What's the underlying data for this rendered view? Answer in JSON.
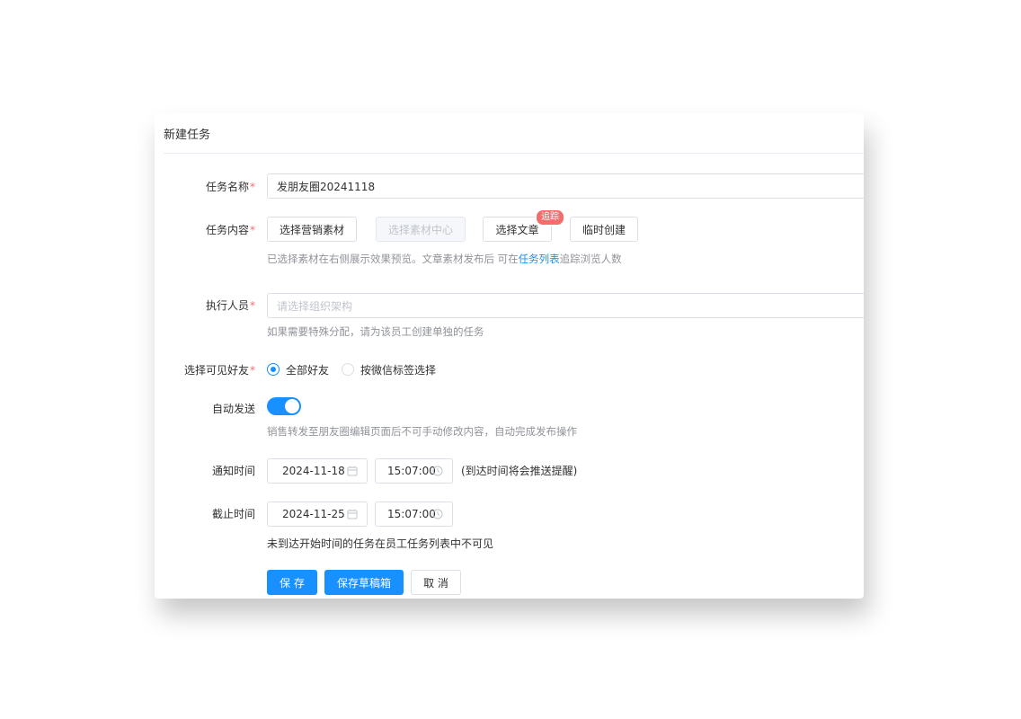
{
  "form": {
    "title": "新建任务",
    "task_name": {
      "label": "任务名称",
      "required_mark": "*",
      "value": "发朋友圈20241118"
    },
    "task_content": {
      "label": "任务内容",
      "required_mark": "*",
      "buttons": {
        "select_marketing": "选择营销素材",
        "select_center": "选择素材中心",
        "select_article": "选择文章",
        "temp_create": "临时创建"
      },
      "badge": "追踪",
      "hint_prefix": "已选择素材在右侧展示效果预览。文章素材发布后 可在",
      "hint_link": "任务列表",
      "hint_suffix": "追踪浏览人数"
    },
    "executor": {
      "label": "执行人员",
      "required_mark": "*",
      "placeholder": "请选择组织架构",
      "hint": "如果需要特殊分配，请为该员工创建单独的任务"
    },
    "visible_friends": {
      "label": "选择可见好友",
      "required_mark": "*",
      "options": [
        "全部好友",
        "按微信标签选择"
      ],
      "selected": "全部好友"
    },
    "auto_send": {
      "label": "自动发送",
      "enabled": true,
      "hint": "销售转发至朋友圈编辑页面后不可手动修改内容，自动完成发布操作"
    },
    "notify_time": {
      "label": "通知时间",
      "date": "2024-11-18",
      "time": "15:07:00",
      "note": "(到达时间将会推送提醒)"
    },
    "deadline": {
      "label": "截止时间",
      "date": "2024-11-25",
      "time": "15:07:00",
      "note": "未到达开始时间的任务在员工任务列表中不可见"
    },
    "actions": {
      "save": "保 存",
      "save_draft": "保存草稿箱",
      "cancel": "取 消"
    }
  },
  "colors": {
    "primary": "#1890ff",
    "required": "#f56c6c",
    "hint": "#909399"
  }
}
